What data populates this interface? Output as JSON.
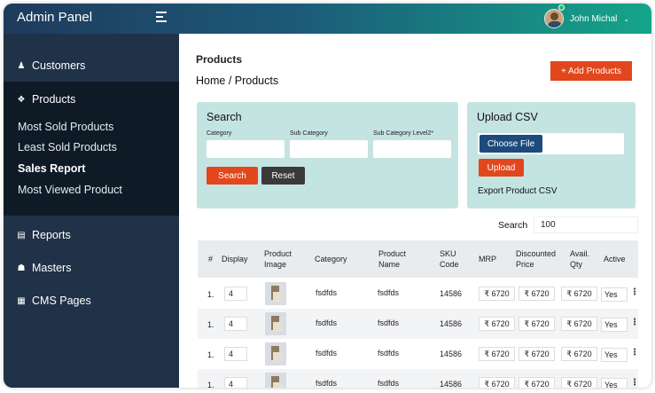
{
  "header": {
    "brand": "Admin Panel",
    "user_name": "John Michal",
    "user_caret": "⌄"
  },
  "sidebar": {
    "customers": "Customers",
    "products": "Products",
    "submenu": [
      "Most Sold Products",
      "Least Sold Products",
      "Sales Report",
      "Most Viewed Product"
    ],
    "active_submenu": "Sales Report",
    "reports": "Reports",
    "masters": "Masters",
    "cms_pages": "CMS Pages"
  },
  "main": {
    "page_title": "Products",
    "breadcrumb": "Home / Products",
    "add_button": "+ Add Products"
  },
  "search_card": {
    "title": "Search",
    "category_label": "Category",
    "subcategory_label": "Sub Category",
    "subcategory2_label": "Sub Category Level2*",
    "search_button": "Search",
    "reset_button": "Reset"
  },
  "upload_card": {
    "title": "Upload CSV",
    "choose_file": "Choose File",
    "upload_button": "Upload",
    "export_link": "Export Product CSV"
  },
  "table_search": {
    "label": "Search",
    "value": "100"
  },
  "table": {
    "headers": [
      "#",
      "Display",
      "Product Image",
      "Category",
      "Product Name",
      "SKU Code",
      "MRP",
      "Discounted Price",
      "Avail. Qty",
      "Active"
    ],
    "rows": [
      {
        "num": "1.",
        "display": "4",
        "category": "fsdfds",
        "name": "fsdfds",
        "sku": "14586",
        "mrp": "₹ 6720",
        "discounted": "₹ 6720",
        "qty": "₹ 6720",
        "active": "Yes",
        "menu": "⋮"
      },
      {
        "num": "1.",
        "display": "4",
        "category": "fsdfds",
        "name": "fsdfds",
        "sku": "14586",
        "mrp": "₹ 6720",
        "discounted": "₹ 6720",
        "qty": "₹ 6720",
        "active": "Yes",
        "menu": "⋮"
      },
      {
        "num": "1.",
        "display": "4",
        "category": "fsdfds",
        "name": "fsdfds",
        "sku": "14586",
        "mrp": "₹ 6720",
        "discounted": "₹ 6720",
        "qty": "₹ 6720",
        "active": "Yes",
        "menu": "⋮"
      },
      {
        "num": "1.",
        "display": "4",
        "category": "fsdfds",
        "name": "fsdfds",
        "sku": "14586",
        "mrp": "₹ 6720",
        "discounted": "₹ 6720",
        "qty": "₹ 6720",
        "active": "Yes",
        "menu": "⋮"
      }
    ]
  },
  "colors": {
    "accent": "#e2461c",
    "sidebar": "#203247",
    "card": "#c4e4e2",
    "topbar_start": "#1f3a5c",
    "topbar_end": "#15a58a"
  }
}
